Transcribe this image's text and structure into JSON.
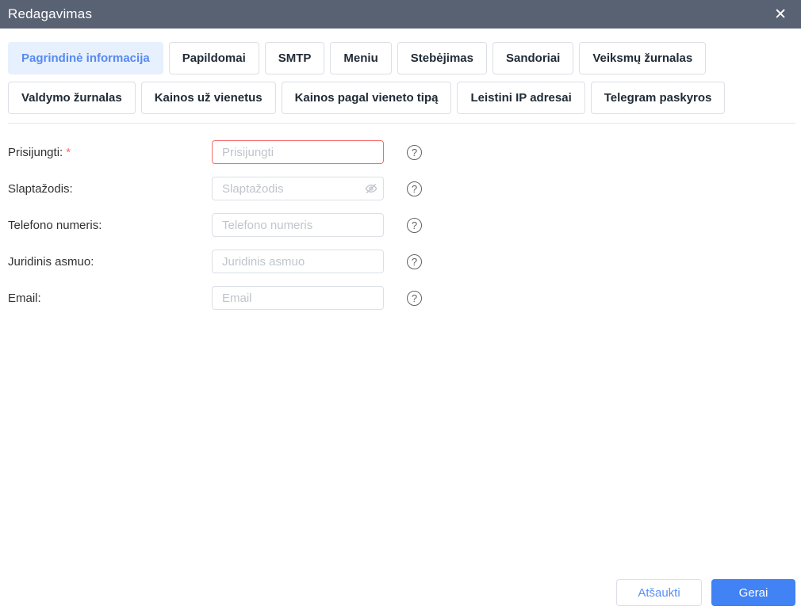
{
  "dialog": {
    "title": "Redagavimas"
  },
  "icons": {
    "close": "✕",
    "help": "?"
  },
  "tabs": {
    "row1": [
      {
        "label": "Pagrindinė informacija",
        "active": true
      },
      {
        "label": "Papildomai",
        "active": false
      },
      {
        "label": "SMTP",
        "active": false
      },
      {
        "label": "Meniu",
        "active": false
      },
      {
        "label": "Stebėjimas",
        "active": false
      },
      {
        "label": "Sandoriai",
        "active": false
      },
      {
        "label": "Veiksmų žurnalas",
        "active": false
      }
    ],
    "row2": [
      {
        "label": "Valdymo žurnalas",
        "active": false
      },
      {
        "label": "Kainos už vienetus",
        "active": false
      },
      {
        "label": "Kainos pagal vieneto tipą",
        "active": false
      },
      {
        "label": "Leistini IP adresai",
        "active": false
      },
      {
        "label": "Telegram paskyros",
        "active": false
      }
    ]
  },
  "form": {
    "required_marker": "*",
    "fields": [
      {
        "label": "Prisijungti:",
        "placeholder": "Prisijungti",
        "value": "",
        "required": true,
        "error": true,
        "password_toggle": false
      },
      {
        "label": "Slaptažodis:",
        "placeholder": "Slaptažodis",
        "value": "",
        "required": false,
        "error": false,
        "password_toggle": true
      },
      {
        "label": "Telefono numeris:",
        "placeholder": "Telefono numeris",
        "value": "",
        "required": false,
        "error": false,
        "password_toggle": false
      },
      {
        "label": "Juridinis asmuo:",
        "placeholder": "Juridinis asmuo",
        "value": "",
        "required": false,
        "error": false,
        "password_toggle": false
      },
      {
        "label": "Email:",
        "placeholder": "Email",
        "value": "",
        "required": false,
        "error": false,
        "password_toggle": false
      }
    ]
  },
  "footer": {
    "cancel_label": "Atšaukti",
    "ok_label": "Gerai"
  },
  "colors": {
    "header_bg": "#596273",
    "accent_blue": "#4182f4",
    "active_tab_bg": "#e7f0fd",
    "active_tab_text": "#568af2",
    "error_red": "#f56c6c",
    "input_border": "#dcdfe6",
    "placeholder": "#c0c4cc"
  }
}
